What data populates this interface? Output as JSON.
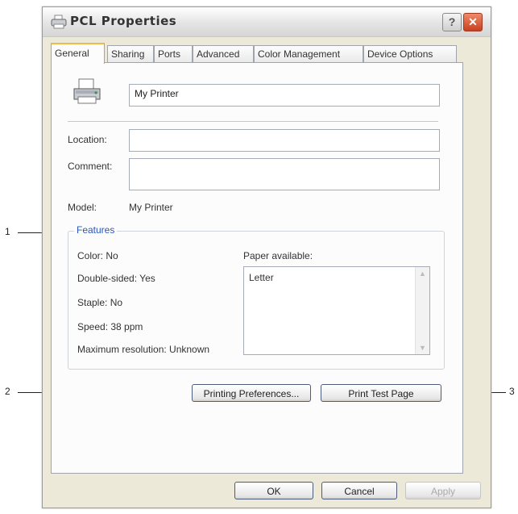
{
  "window": {
    "title": "PCL  Properties",
    "help_label": "?",
    "close_label": "✕"
  },
  "tabs": [
    {
      "label": "General",
      "active": true
    },
    {
      "label": "Sharing"
    },
    {
      "label": "Ports"
    },
    {
      "label": "Advanced"
    },
    {
      "label": "Color Management"
    },
    {
      "label": "Device Options"
    }
  ],
  "general": {
    "printer_name": "My Printer",
    "location_label": "Location:",
    "location_value": "",
    "comment_label": "Comment:",
    "comment_value": "",
    "model_label": "Model:",
    "model_value": "My Printer"
  },
  "features": {
    "label": "Features",
    "color": "Color: No",
    "double_sided": "Double-sided: Yes",
    "staple": "Staple: No",
    "speed": "Speed: 38 ppm",
    "max_resolution": "Maximum resolution: Unknown",
    "paper_label": "Paper available:",
    "paper_items": [
      "Letter"
    ]
  },
  "buttons": {
    "printing_preferences": "Printing Preferences...",
    "print_test_page": "Print Test Page",
    "ok": "OK",
    "cancel": "Cancel",
    "apply": "Apply"
  },
  "callouts": [
    "1",
    "2",
    "3"
  ],
  "icons": {
    "title": "printer-icon",
    "printer": "printer-icon",
    "help": "help-icon",
    "close": "close-icon"
  },
  "colors": {
    "active_tab_accent": "#f2b84b",
    "close_button": "#d6532f",
    "group_label": "#2b57b8"
  }
}
